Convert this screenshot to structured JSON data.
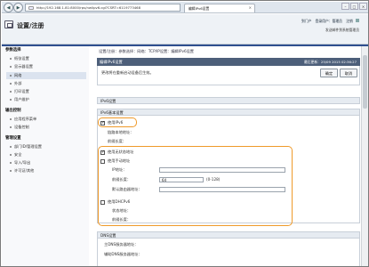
{
  "browser": {
    "url_domain": "192.168.1.81",
    "url_full": "http://192.168.1.81:8000/rps/nwlipv6.cgi?CSRT=6119773468",
    "tab_title": "编辑IPv6设置"
  },
  "header": {
    "app_title": "设置/注册",
    "top_links": [
      "到门户",
      "登录用户：管理员",
      "注销"
    ],
    "manual_link": "发送邮件到系统管理员"
  },
  "sidebar": {
    "sections": [
      {
        "title": "参数选择",
        "items": [
          "纸张设置",
          "显示器设置",
          "网络",
          "外部",
          "打印设置",
          "用户维护"
        ],
        "active": 2
      },
      {
        "title": "输出控制",
        "items": [
          "应用程序菜单",
          "设备控制"
        ]
      },
      {
        "title": "管理设置",
        "items": [
          "部门ID/管理设置",
          "安全",
          "导入/导出",
          "许可证/其他"
        ]
      }
    ]
  },
  "breadcrumb": "设置/注册：参数选择：网络：TCP/IP设置：编辑IPv6设置",
  "panel": {
    "title": "编辑IPv6设置",
    "last_updated": "最后更新：25/09 2015 02:36:27",
    "description": "更改将在重新启动设备后生效。",
    "ok_label": "确定",
    "cancel_label": "取消"
  },
  "ipv6_basic": {
    "title": "IPv6设置",
    "sub_title": "IPv6基本设置"
  },
  "ipv6": {
    "use_ipv6_label": "使用IPv6",
    "use_ipv6_checked": true,
    "link_local_label": "链路本地地址：",
    "prefix_length_label": "前缀长度："
  },
  "stateless": {
    "label": "使用无状态地址",
    "checked": true
  },
  "manual": {
    "label": "使用手动地址",
    "checked": false,
    "ip_label": "IP地址：",
    "prefix_label": "前缀长度：",
    "prefix_value": "64",
    "prefix_hint": "(0-128)",
    "gateway_label": "默认路由器地址："
  },
  "dhcp": {
    "label": "使用DHCPv6",
    "checked": false,
    "state_label": "状态地址：",
    "prefix_label": "前缀长度："
  },
  "dns": {
    "title": "DNS设置",
    "primary_label": "主DNS服务器地址：",
    "secondary_label": "辅助DNS服务器地址："
  }
}
